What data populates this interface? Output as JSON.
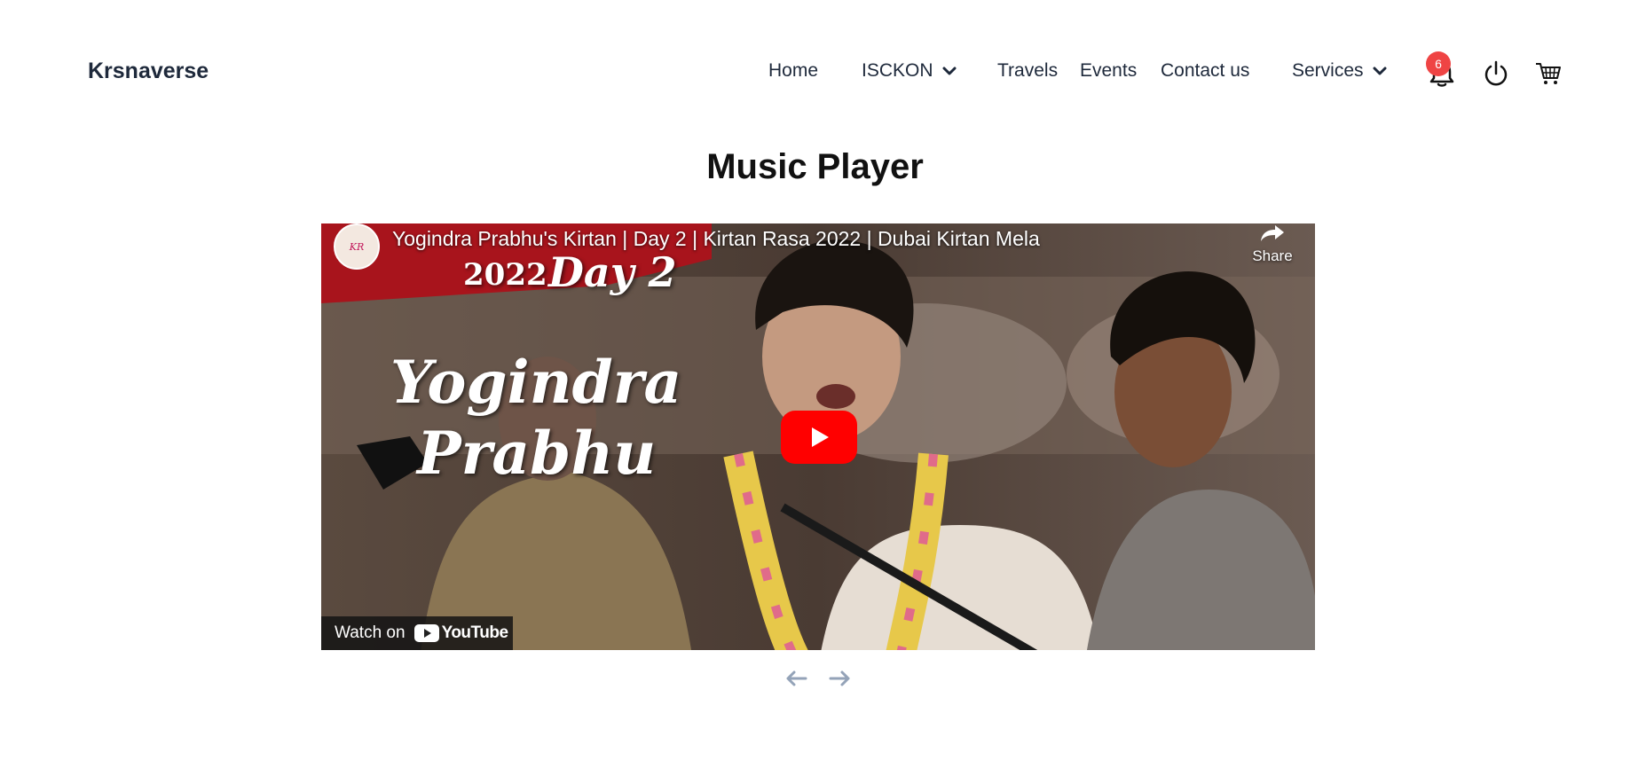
{
  "brand": "Krsnaverse",
  "nav": {
    "home": "Home",
    "iskcon": "ISCKON",
    "travels": "Travels",
    "events": "Events",
    "contact": "Contact us",
    "services": "Services"
  },
  "header_icons": {
    "notifications": {
      "icon": "bell-icon",
      "count": "6"
    },
    "power": {
      "icon": "power-icon"
    },
    "cart": {
      "icon": "cart-icon"
    }
  },
  "page_title": "Music Player",
  "video": {
    "title": "Yogindra Prabhu's Kirtan | Day 2 | Kirtan Rasa 2022 | Dubai Kirtan Mela",
    "share_label": "Share",
    "watch_on": "Watch on",
    "youtube": "YouTube",
    "thumbnail_text": {
      "year": "2022",
      "day": "Day 2",
      "name_line1": "Yogindra",
      "name_line2": "Prabhu"
    }
  },
  "pager": {
    "prev_icon": "arrow-left-icon",
    "next_icon": "arrow-right-icon"
  },
  "colors": {
    "badge": "#ef4444",
    "play": "#ff0000",
    "arrow": "#94a3b8"
  }
}
